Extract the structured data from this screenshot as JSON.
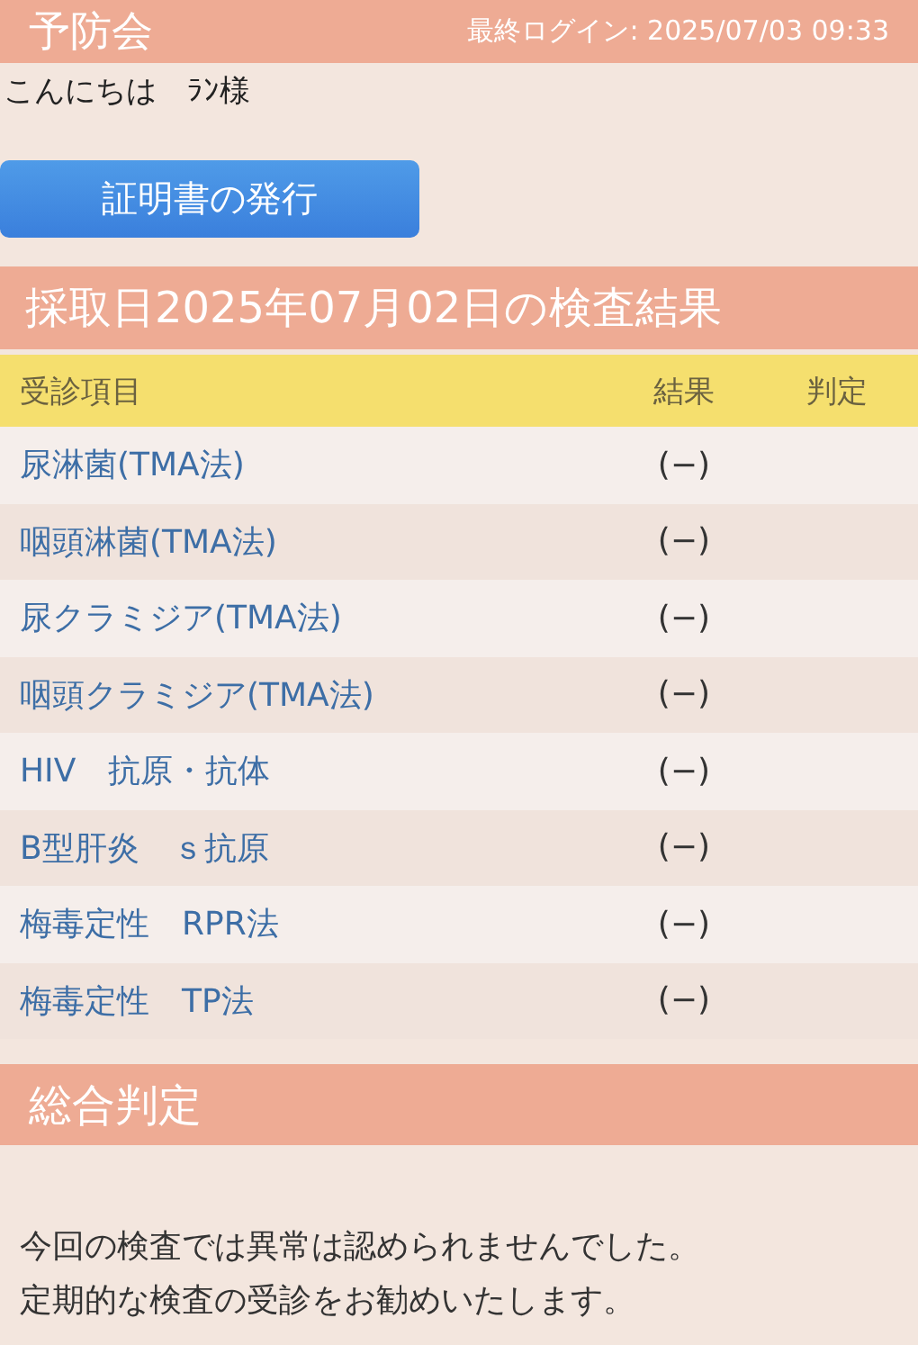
{
  "header": {
    "title": "予防会",
    "last_login": "最終ログイン: 2025/07/03 09:33"
  },
  "greeting": "こんにちは　ﾗﾝ様",
  "certificate_button": "証明書の発行",
  "results": {
    "title": "採取日2025年07月02日の検査結果",
    "columns": [
      "受診項目",
      "結果",
      "判定"
    ],
    "rows": [
      {
        "item": "尿淋菌(TMA法)",
        "result": "(−)"
      },
      {
        "item": "咽頭淋菌(TMA法)",
        "result": "(−)"
      },
      {
        "item": "尿クラミジア(TMA法)",
        "result": "(−)"
      },
      {
        "item": "咽頭クラミジア(TMA法)",
        "result": "(−)"
      },
      {
        "item": "HIV　抗原・抗体",
        "result": "(−)"
      },
      {
        "item": "B型肝炎　ｓ抗原",
        "result": "(−)"
      },
      {
        "item": "梅毒定性　RPR法",
        "result": "(−)"
      },
      {
        "item": "梅毒定性　TP法",
        "result": "(−)"
      }
    ]
  },
  "overall": {
    "title": "総合判定",
    "lines": [
      "今回の検査では異常は認められませんでした。",
      "定期的な検査の受診をお勧めいたします。"
    ]
  }
}
